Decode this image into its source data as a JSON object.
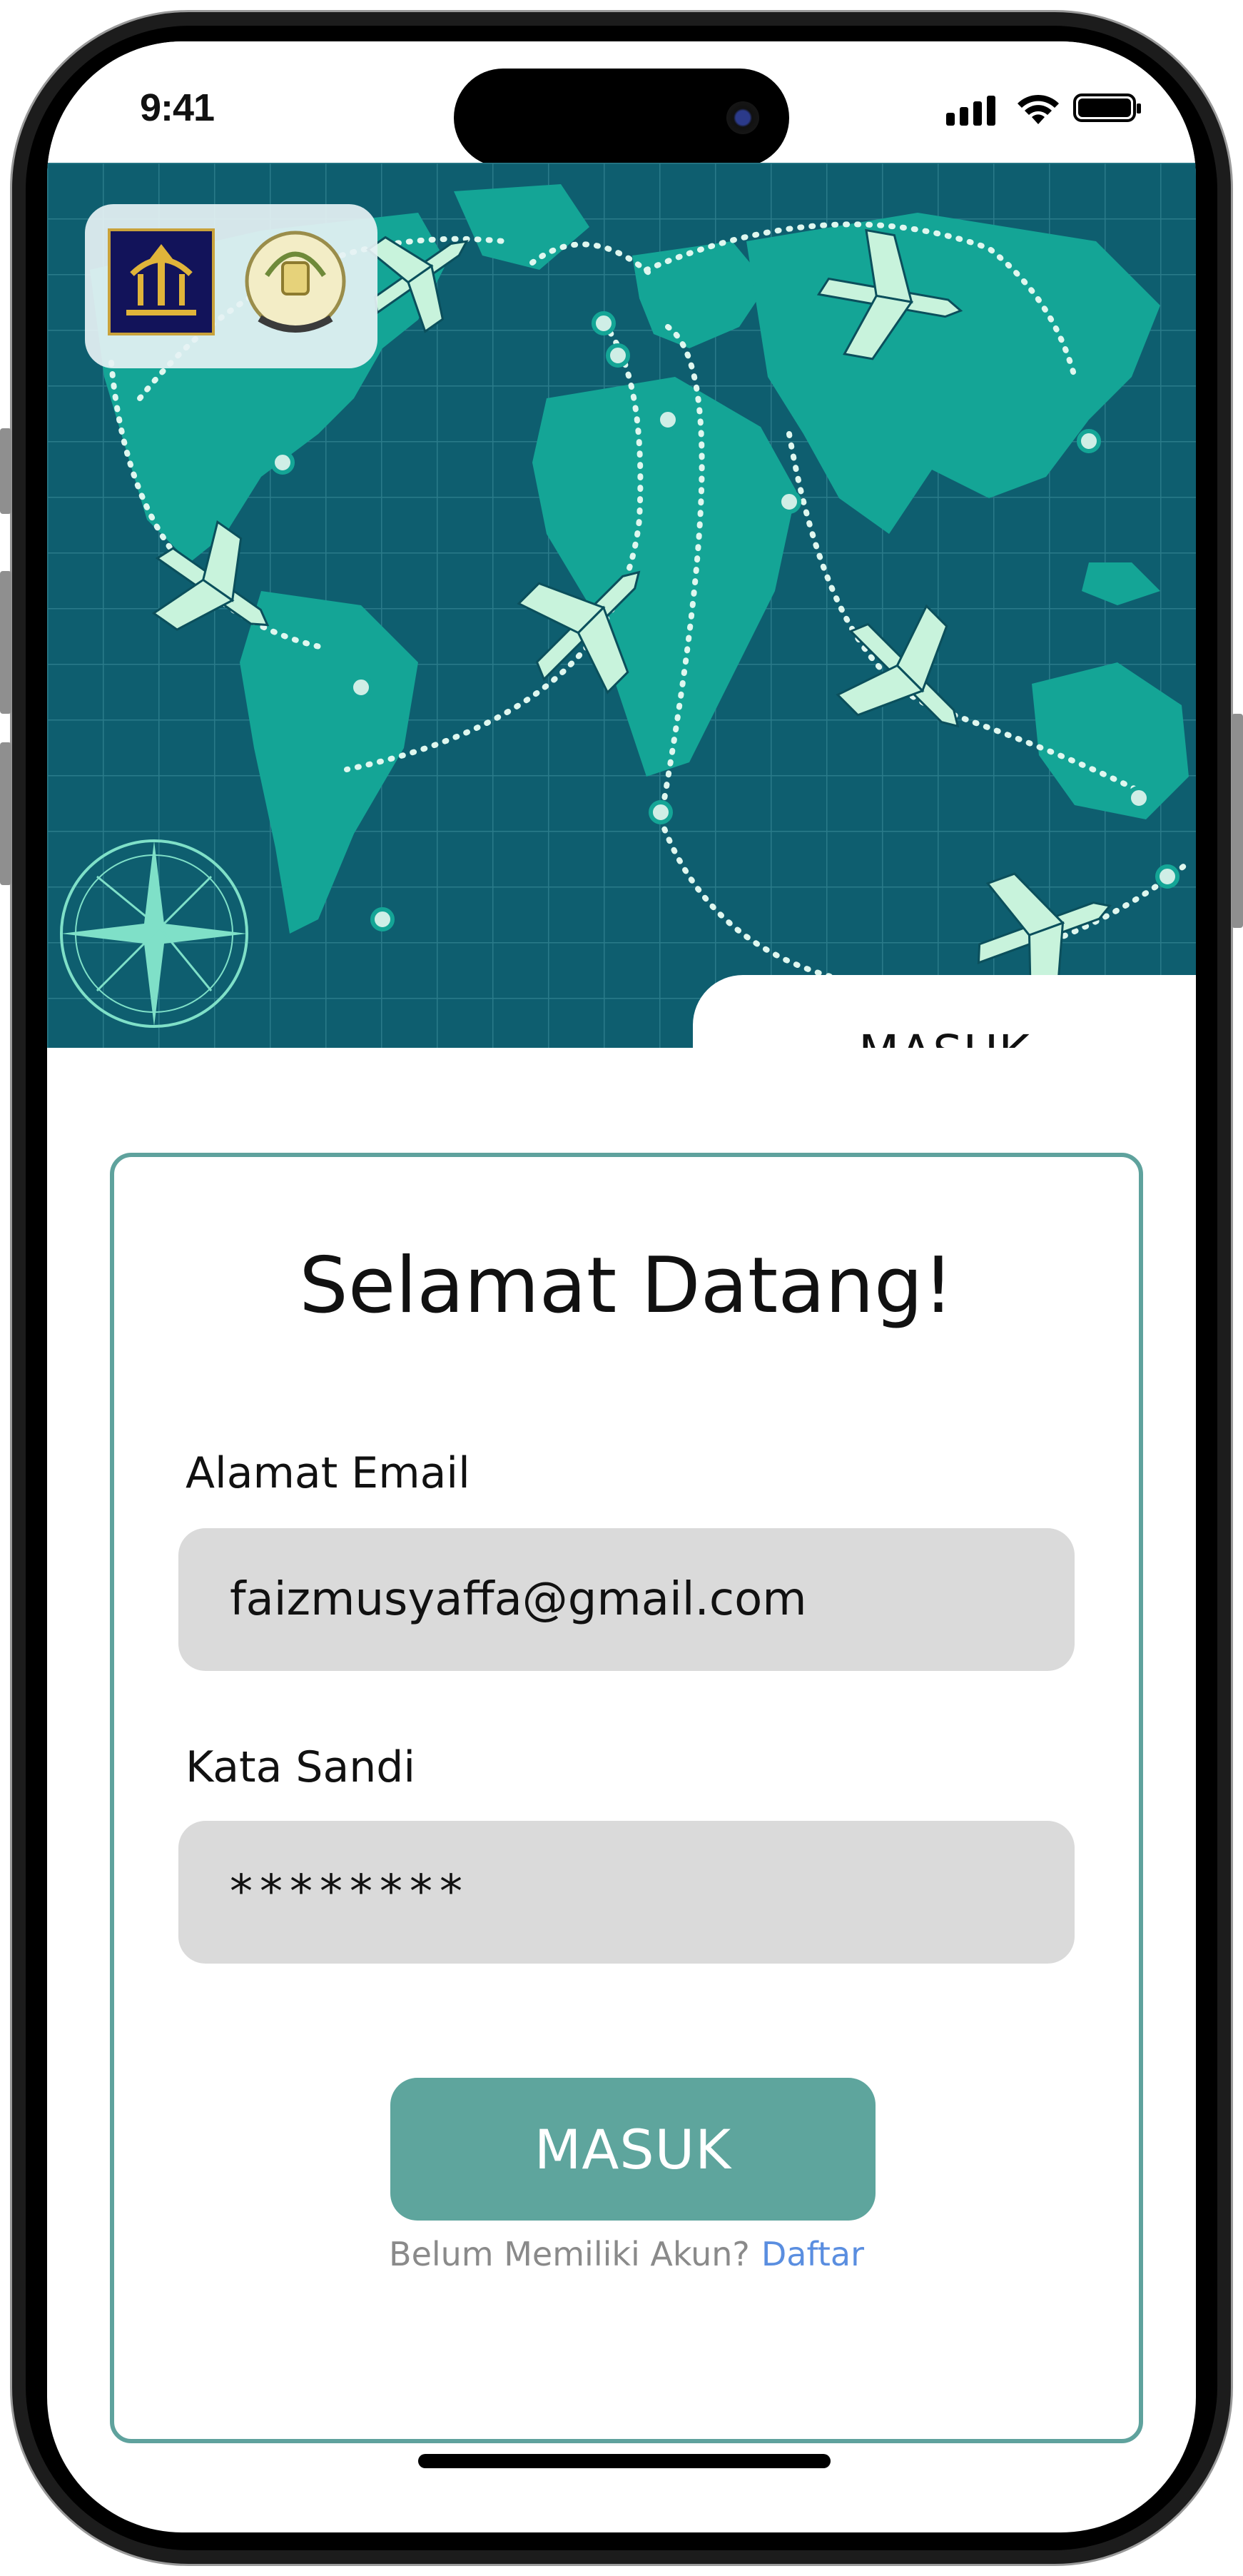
{
  "status_bar": {
    "time": "9:41"
  },
  "hero": {
    "tab_label": "MASUK"
  },
  "login": {
    "title": "Selamat Datang!",
    "email_label": "Alamat Email",
    "email_value": "faizmusyaffa@gmail.com",
    "password_label": "Kata Sandi",
    "password_value": "********",
    "submit_label": "MASUK",
    "no_account_text": "Belum Memiliki Akun?",
    "register_link": "Daftar"
  },
  "colors": {
    "map_bg": "#0e5e6f",
    "accent": "#5ea59d",
    "link": "#5a8ee0"
  }
}
